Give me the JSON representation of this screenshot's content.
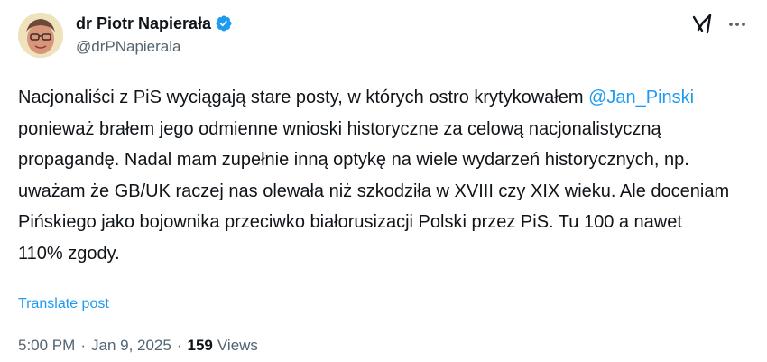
{
  "author": {
    "display_name": "dr Piotr Napierała",
    "handle": "@drPNapierala",
    "verified": true
  },
  "tweet": {
    "text_part1": "Nacjonaliści z PiS wyciągają stare posty, w których ostro krytykowałem ",
    "mention": "@Jan_Pinski",
    "text_part2": " ponieważ brałem jego odmienne wnioski historyczne za celową nacjonalistyczną propagandę. Nadal mam zupełnie inną optykę na wiele wydarzeń historycznych, np. uważam że GB/UK raczej nas olewała niż szkodziła w XVIII czy XIX wieku. Ale doceniam Pińskiego jako bojownika przeciwko białorusizacji Polski przez PiS. Tu 100 a nawet 110% zgody.",
    "translate_label": "Translate post"
  },
  "meta": {
    "time": "5:00 PM",
    "separator": "·",
    "date": "Jan 9, 2025",
    "views_count": "159",
    "views_label": "Views"
  },
  "icons": {
    "verified": "verified-badge-icon",
    "grok": "grok-icon",
    "more": "more-options-icon"
  },
  "colors": {
    "accent": "#1d9bf0",
    "text": "#0f1419",
    "secondary": "#536471"
  }
}
